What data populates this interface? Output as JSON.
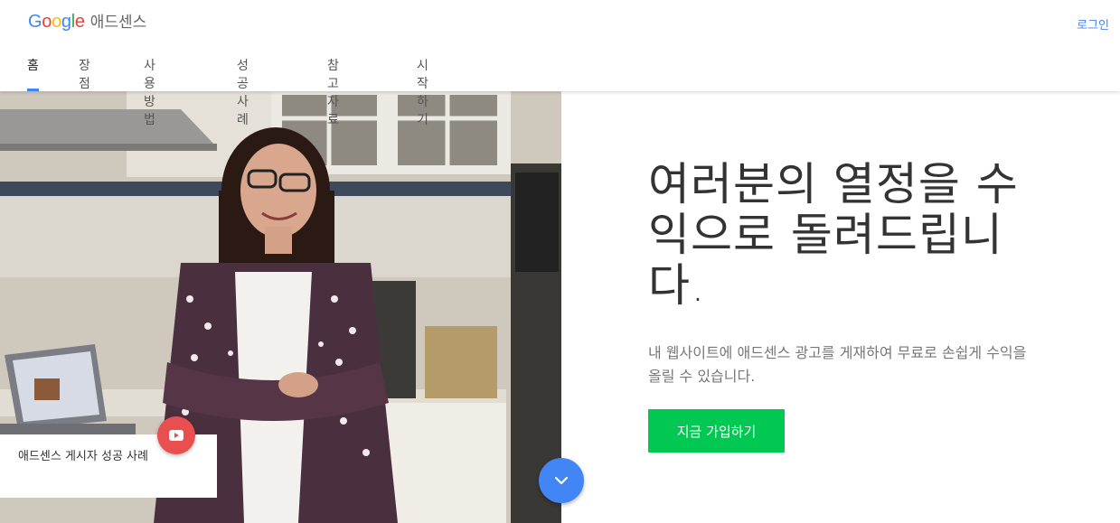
{
  "header": {
    "logo_text": "Google",
    "product_name": "애드센스",
    "login_label": "로그인"
  },
  "nav": {
    "items": [
      {
        "label": "홈",
        "active": true
      },
      {
        "label": "장점",
        "active": false
      },
      {
        "label": "사용 방법",
        "active": false
      },
      {
        "label": "성공사례",
        "active": false
      },
      {
        "label": "참고자료",
        "active": false
      },
      {
        "label": "시작하기",
        "active": false
      }
    ]
  },
  "hero": {
    "headline": "여러분의 열정을 수익으로 돌려드립니다.",
    "subtext": "내 웹사이트에 애드센스 광고를 게재하여 무료로 손쉽게 수익을 올릴 수 있습니다.",
    "cta_label": "지금 가입하기",
    "story_card_text": "애드센스 게시자 성공 사례",
    "play_icon": "youtube-play-icon",
    "scroll_icon": "chevron-down-icon"
  },
  "colors": {
    "accent_blue": "#4285f4",
    "cta_green": "#00c853",
    "play_red": "#ea4f4f"
  }
}
